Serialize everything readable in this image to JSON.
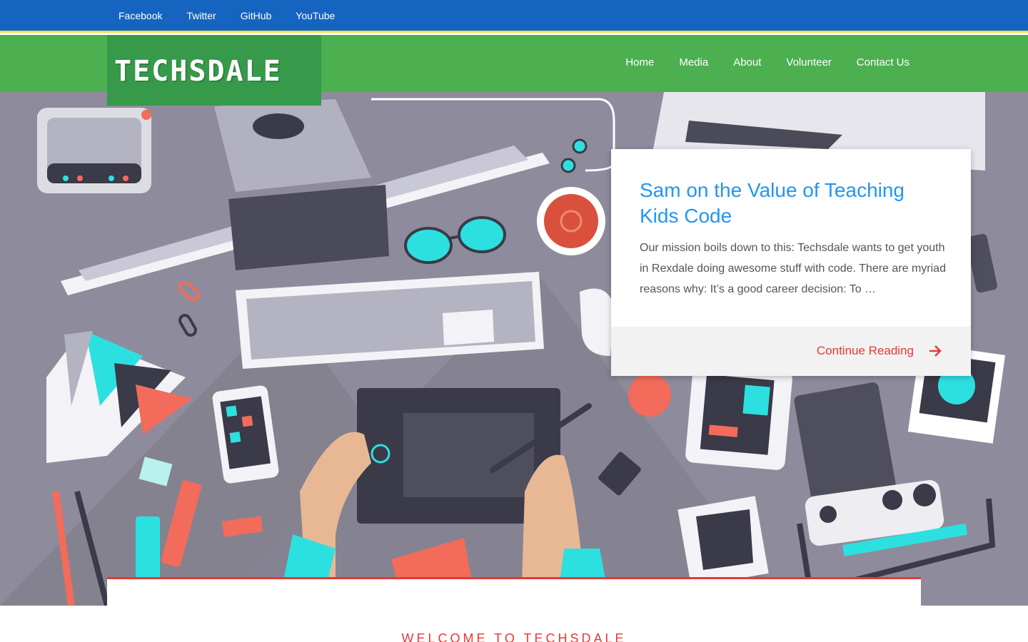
{
  "social": {
    "items": [
      {
        "label": "Facebook"
      },
      {
        "label": "Twitter"
      },
      {
        "label": "GitHub"
      },
      {
        "label": "YouTube"
      }
    ]
  },
  "header": {
    "logo_text": "TECHSDALE",
    "nav": [
      {
        "label": "Home"
      },
      {
        "label": "Media"
      },
      {
        "label": "About"
      },
      {
        "label": "Volunteer"
      },
      {
        "label": "Contact Us"
      }
    ]
  },
  "featured_post": {
    "title": "Sam on the Value of Teaching Kids Code",
    "excerpt": "Our mission boils down to this: Techsdale wants to get youth in Rexdale doing awesome stuff with code. There are myriad reasons why: It’s a good career decision: To …",
    "continue_label": "Continue Reading",
    "continue_icon": "arrow-right-icon"
  },
  "main": {
    "welcome_heading": "WELCOME TO TECHSDALE"
  },
  "colors": {
    "topbar": "#1565c0",
    "navbar": "#4caf50",
    "logo_bg": "#37994a",
    "accent_red": "#e53935",
    "link_blue": "#2196f3",
    "hero_bg": "#8e8c9c"
  }
}
